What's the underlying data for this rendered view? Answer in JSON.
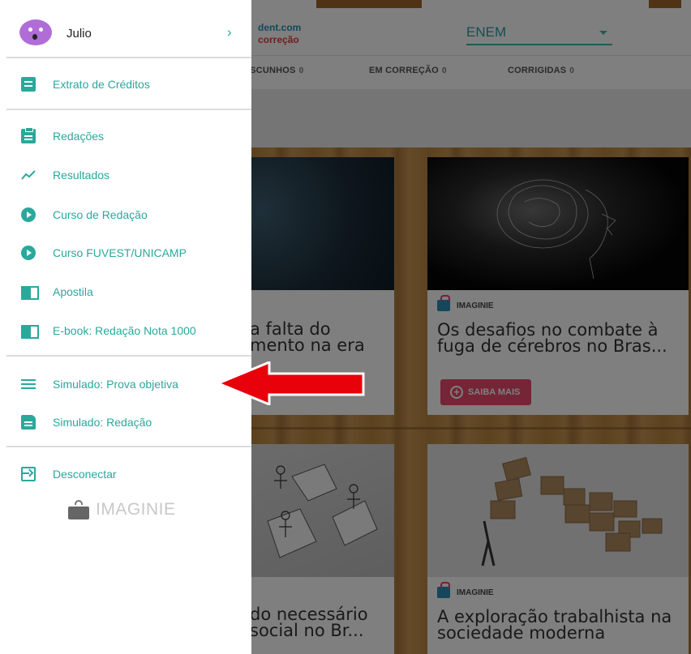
{
  "user": {
    "name": "Julio"
  },
  "drawer": {
    "credits": "Extrato de Créditos",
    "items_main": [
      {
        "label": "Redações",
        "icon": "clipboard-icon"
      },
      {
        "label": "Resultados",
        "icon": "trending-icon"
      },
      {
        "label": "Curso de Redação",
        "icon": "play-circle-icon"
      },
      {
        "label": "Curso FUVEST/UNICAMP",
        "icon": "play-circle-icon"
      },
      {
        "label": "Apostila",
        "icon": "book-icon"
      },
      {
        "label": "E-book: Redação Nota 1000",
        "icon": "book-icon"
      }
    ],
    "items_sim": [
      {
        "label": "Simulado: Prova objetiva",
        "icon": "list-icon"
      },
      {
        "label": "Simulado: Redação",
        "icon": "document-icon"
      }
    ],
    "logout": "Desconectar",
    "logo": "IMAGINIE"
  },
  "header": {
    "site_partial": "dent.com",
    "site_sub_partial": "correção",
    "exam_selected": "ENEM"
  },
  "tabs": [
    {
      "label": "ASCUNHOS",
      "count": "0"
    },
    {
      "label": "EM CORREÇÃO",
      "count": "0"
    },
    {
      "label": "CORRIGIDAS",
      "count": "0"
    }
  ],
  "cards": [
    {
      "brand": "",
      "title": "a falta do\nmento na era",
      "button": ""
    },
    {
      "brand": "IMAGINIE",
      "title": "Os desafios no combate à fuga de cérebros no Bras...",
      "button": "SAIBA MAIS"
    },
    {
      "brand": "",
      "title": "do necessário\nsocial no Br...",
      "button": ""
    },
    {
      "brand": "IMAGINIE",
      "title": "A exploração trabalhista na sociedade moderna",
      "button": ""
    }
  ],
  "colors": {
    "accent": "#2aa89c",
    "primary_button": "#e84a6d",
    "annotation_arrow": "#e8000b"
  }
}
